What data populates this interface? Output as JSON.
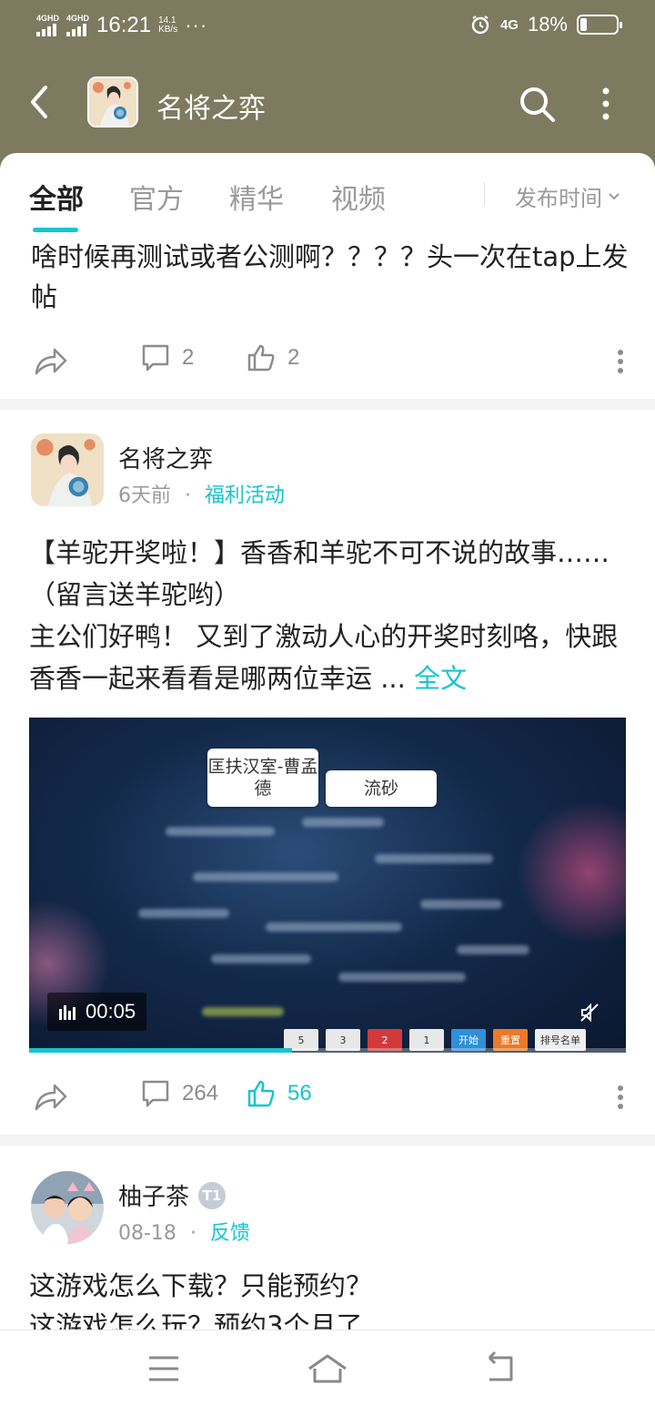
{
  "status_bar": {
    "signal1": "4GHD",
    "signal2": "4GHD",
    "time": "16:21",
    "net_speed_value": "14.1",
    "net_speed_unit": "KB/s",
    "overflow": "···",
    "network": "4G",
    "battery": "18%",
    "battery_level": 0.18
  },
  "app_bar": {
    "title": "名将之弈",
    "icons": [
      "back-arrow-icon",
      "search-icon",
      "more-vertical-icon"
    ]
  },
  "tabs": [
    {
      "label": "全部",
      "active": true
    },
    {
      "label": "官方",
      "active": false
    },
    {
      "label": "精华",
      "active": false
    },
    {
      "label": "视频",
      "active": false
    }
  ],
  "sort": {
    "label": "发布时间"
  },
  "posts": [
    {
      "text": "啥时候再测试或者公测啊？？？？头一次在tap上发帖",
      "comments": "2",
      "likes": "2",
      "liked": false
    },
    {
      "author": "名将之弈",
      "time": "6天前",
      "separator": "·",
      "category": "福利活动",
      "title": "【羊驼开奖啦！】香香和羊驼不可不说的故事……（留言送羊驼哟）",
      "body": "主公们好鸭！ 又到了激动人心的开奖时刻咯，快跟香香一起来看看是哪两位幸运 ...",
      "more": "全文",
      "video": {
        "card1": "匡扶汉室-曹孟德",
        "card2": "流砂",
        "duration": "00:05",
        "progress": 0.44,
        "buttons": [
          "5",
          "3",
          "2",
          "1",
          "开始",
          "重置",
          "排号名单"
        ]
      },
      "comments": "264",
      "likes": "56",
      "liked": true
    },
    {
      "author": "柚子茶",
      "badge": "T1",
      "time": "08-18",
      "separator": "·",
      "category": "反馈",
      "text": "这游戏怎么下载？只能预约？",
      "text2": "这游戏怎么玩？预约3个月了"
    }
  ],
  "colors": {
    "accent": "#15c5ce",
    "header": "#7e7a5f"
  }
}
